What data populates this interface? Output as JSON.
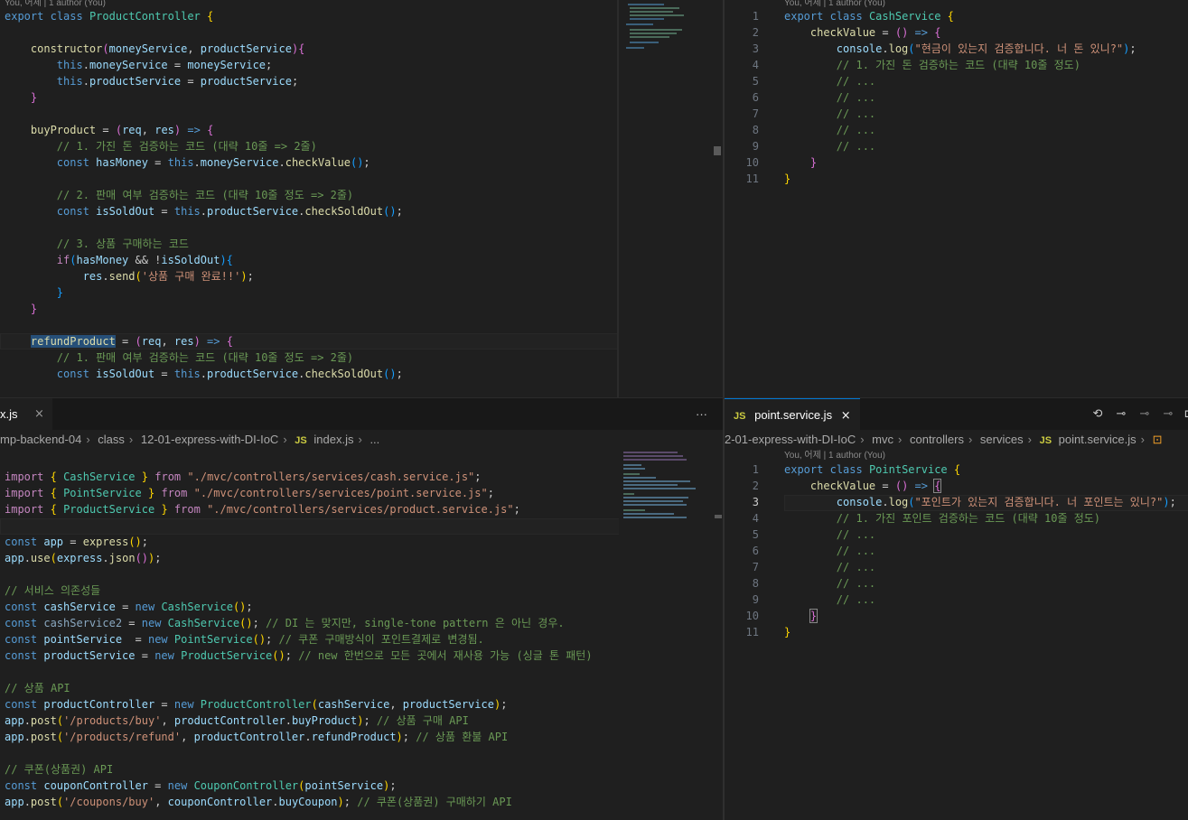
{
  "colors": {
    "editor_bg": "#1f1f1f",
    "tab_bar_bg": "#181818",
    "keyword": "#569cd6",
    "class": "#4ec9b0",
    "function": "#dcdcaa",
    "variable": "#9cdcfe",
    "string": "#ce9178",
    "comment": "#6a9955"
  },
  "top_left": {
    "blame": "You, 어제 | 1 author (You)",
    "lines": [
      "export class ProductController {",
      "",
      "    constructor(moneyService, productService){",
      "        this.moneyService = moneyService;",
      "        this.productService = productService;",
      "    }",
      "",
      "    buyProduct = (req, res) => {",
      "        // 1. 가진 돈 검증하는 코드 (대략 10줄 => 2줄)",
      "        const hasMoney = this.moneyService.checkValue();",
      "",
      "        // 2. 판매 여부 검증하는 코드 (대략 10줄 정도 => 2줄)",
      "        const isSoldOut = this.productService.checkSoldOut();",
      "",
      "        // 3. 상품 구매하는 코드",
      "        if(hasMoney && !isSoldOut){",
      "            res.send('상품 구매 완료!!');",
      "        }",
      "    }",
      "",
      "    refundProduct = (req, res) => {",
      "        // 1. 판매 여부 검증하는 코드 (대략 10줄 정도 => 2줄)",
      "        const isSoldOut = this.productService.checkSoldOut();"
    ]
  },
  "top_right": {
    "blame": "You, 어제 | 1 author (You)",
    "line_numbers": [
      "1",
      "2",
      "3",
      "4",
      "5",
      "6",
      "7",
      "8",
      "9",
      "10",
      "11"
    ],
    "lines": [
      "export class CashService {",
      "    checkValue = () => {",
      "        console.log(\"현금이 있는지 검증합니다. 너 돈 있니?\");",
      "        // 1. 가진 돈 검증하는 코드 (대략 10줄 정도)",
      "        // ...",
      "        // ...",
      "        // ...",
      "        // ...",
      "        // ...",
      "    }",
      "}"
    ]
  },
  "bottom_left": {
    "tab_label": "x.js",
    "more_actions": "···",
    "breadcrumbs": [
      "mp-backend-04",
      "class",
      "12-01-express-with-DI-IoC",
      "index.js",
      "..."
    ],
    "breadcrumb_js_badge": "JS",
    "lines": [
      "import { CashService } from \"./mvc/controllers/services/cash.service.js\";",
      "import { PointService } from \"./mvc/controllers/services/point.service.js\";",
      "import { ProductService } from \"./mvc/controllers/services/product.service.js\";",
      "",
      "const app = express();",
      "app.use(express.json());",
      "",
      "// 서비스 의존성들",
      "const cashService = new CashService();",
      "const cashService2 = new CashService(); // DI 는 맞지만, single-tone pattern 은 아닌 경우.",
      "const pointService  = new PointService(); // 쿠폰 구매방식이 포인트결제로 변경됨.",
      "const productService = new ProductService(); // new 한번으로 모든 곳에서 재사용 가능 (싱글 톤 패턴)",
      "",
      "// 상품 API",
      "const productController = new ProductController(cashService, productService);",
      "app.post('/products/buy', productController.buyProduct); // 상품 구매 API",
      "app.post('/products/refund', productController.refundProduct); // 상품 환불 API",
      "",
      "// 쿠폰(상품권) API",
      "const couponController = new CouponController(pointService);",
      "app.post('/coupons/buy', couponController.buyCoupon); // 쿠폰(상품권) 구매하기 API"
    ]
  },
  "bottom_right": {
    "tab_js_badge": "JS",
    "tab_label": "point.service.js",
    "tab_close": "×",
    "breadcrumbs": [
      "2-01-express-with-DI-IoC",
      "mvc",
      "controllers",
      "services",
      "point.service.js"
    ],
    "breadcrumb_js_badge": "JS",
    "blame": "You, 어제 | 1 author (You)",
    "line_numbers": [
      "1",
      "2",
      "3",
      "4",
      "5",
      "6",
      "7",
      "8",
      "9",
      "10",
      "11"
    ],
    "lines": [
      "export class PointService {",
      "    checkValue = () => {",
      "        console.log(\"포인트가 있는지 검증합니다. 너 포인트는 있니?\");",
      "        // 1. 가진 포인트 검증하는 코드 (대략 10줄 정도)",
      "        // ...",
      "        // ...",
      "        // ...",
      "        // ...",
      "        // ...",
      "    }",
      "}"
    ]
  }
}
